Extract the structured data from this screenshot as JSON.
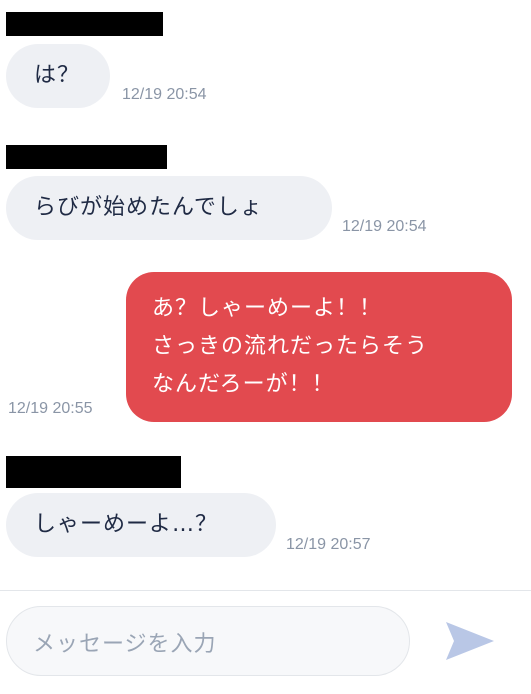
{
  "messages": [
    {
      "direction": "in",
      "text": "は？",
      "time": "12/19 20:54"
    },
    {
      "direction": "in",
      "text": "らびが始めたんでしょ",
      "time": "12/19 20:54"
    },
    {
      "direction": "out",
      "lines": [
        "あ？しゃーめーよ！！",
        "さっきの流れだったらそう",
        "なんだろーが！！"
      ],
      "time": "12/19 20:55"
    },
    {
      "direction": "in",
      "text": "しゃーめーよ…？",
      "time": "12/19 20:57"
    }
  ],
  "composer": {
    "placeholder": "メッセージを入力",
    "send_icon": "send-icon"
  },
  "colors": {
    "outgoing": "#e24a4f",
    "incoming": "#eef0f4",
    "timestamp": "#8a95a6",
    "send": "#b9c7e6"
  }
}
